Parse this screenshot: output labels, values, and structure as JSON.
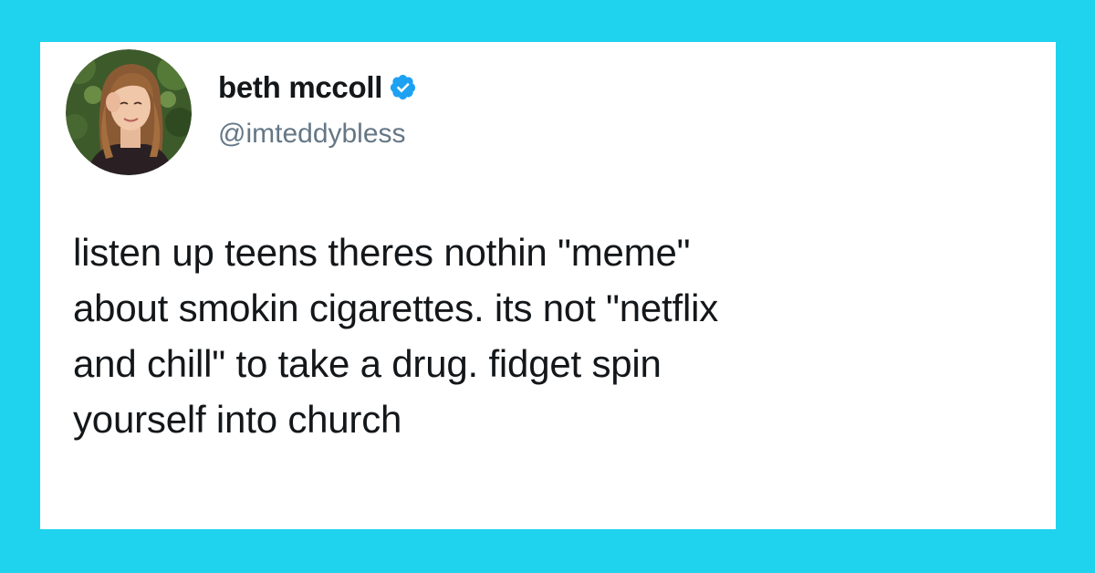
{
  "colors": {
    "background": "#1fd3ee",
    "card": "#ffffff",
    "text": "#14171a",
    "secondary_text": "#657786",
    "verified_badge": "#1da1f2"
  },
  "author": {
    "display_name": "beth mccoll",
    "handle": "@imteddybless",
    "verified": true,
    "avatar_icon": "profile-photo",
    "verified_icon": "verified-badge-icon"
  },
  "tweet": {
    "lines": [
      "listen up teens theres nothin \"meme\"",
      "about smokin cigarettes. its not \"netflix",
      "and chill\" to take a drug. fidget spin",
      "yourself into church"
    ]
  }
}
